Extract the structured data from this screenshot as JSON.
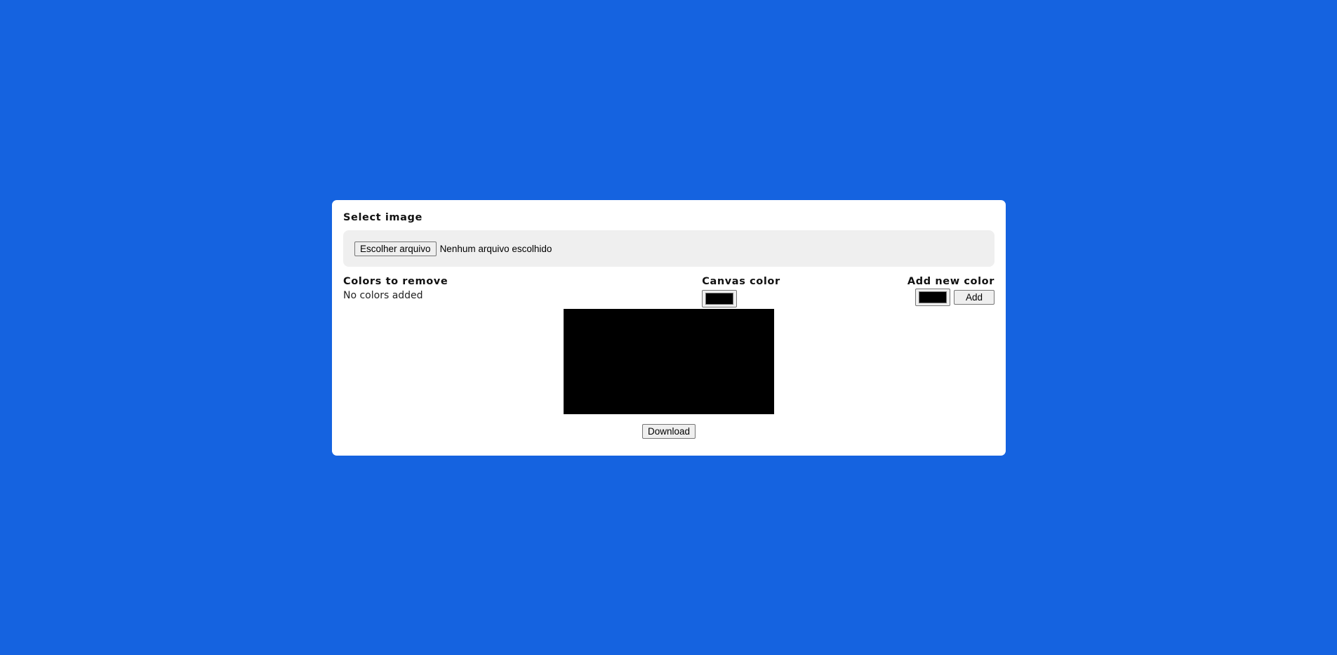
{
  "select_image": {
    "title": "Select image",
    "choose_label": "Escolher arquivo",
    "status": "Nenhum arquivo escolhido"
  },
  "colors_to_remove": {
    "title": "Colors to remove",
    "empty": "No colors added"
  },
  "canvas_color": {
    "title": "Canvas color",
    "value": "#000000"
  },
  "add_new_color": {
    "title": "Add new color",
    "value": "#000000",
    "add_label": "Add"
  },
  "preview": {
    "fill": "#000000"
  },
  "download_label": "Download",
  "colors": {
    "background": "#1563e0",
    "panel": "#ffffff",
    "file_box": "#efefef"
  }
}
